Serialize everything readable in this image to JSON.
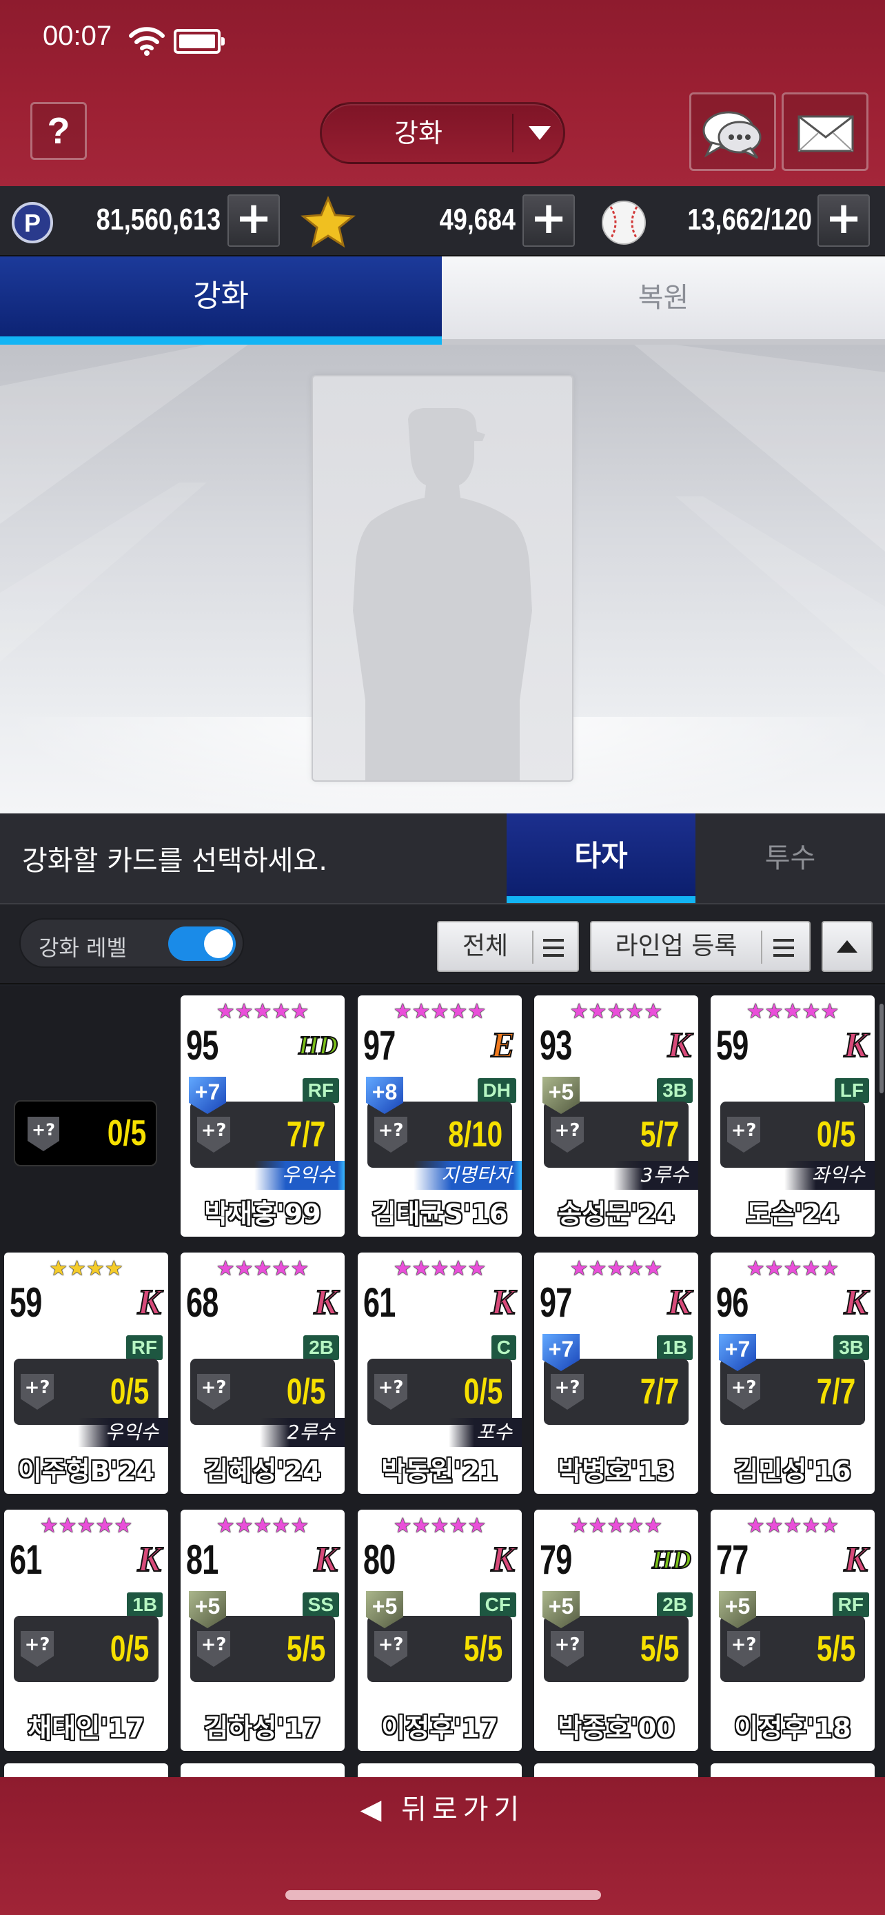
{
  "status_bar": {
    "time": "00:07"
  },
  "header": {
    "help_label": "?",
    "mode_label": "강화"
  },
  "currency": {
    "points": "81,560,613",
    "stars": "49,684",
    "balls": "13,662/120"
  },
  "tabs": {
    "enhance": "강화",
    "restore": "복원"
  },
  "select_row": {
    "message": "강화할 카드를 선택하세요.",
    "batter_tab": "타자",
    "pitcher_tab": "투수"
  },
  "filter": {
    "toggle_label": "강화 레벨",
    "all_label": "전체",
    "lineup_label": "라인업 등록"
  },
  "slot": {
    "value": "0/5"
  },
  "cards": [
    {
      "stars": "★★★★★",
      "ovr": "95",
      "team": "HD",
      "pos": "RF",
      "plus": "+7",
      "plus_color": "blue",
      "progress": "7/7",
      "skill": "우익수",
      "skill_style": "blue",
      "name": "박재홍'99"
    },
    {
      "stars": "★★★★★",
      "ovr": "97",
      "team": "E",
      "pos": "DH",
      "plus": "+8",
      "plus_color": "blue",
      "progress": "8/10",
      "skill": "지명타자",
      "skill_style": "blue",
      "name": "김태균S'16"
    },
    {
      "stars": "★★★★★",
      "ovr": "93",
      "team": "K",
      "pos": "3B",
      "plus": "+5",
      "plus_color": "olive",
      "progress": "5/7",
      "skill": "3루수",
      "skill_style": "dark",
      "name": "송성문'24"
    },
    {
      "stars": "★★★★★",
      "ovr": "59",
      "team": "K",
      "pos": "LF",
      "plus": "",
      "plus_color": "",
      "progress": "0/5",
      "skill": "좌익수",
      "skill_style": "dark",
      "name": "도슨'24"
    },
    {
      "stars": "★★★★",
      "ovr": "59",
      "team": "K",
      "pos": "RF",
      "plus": "",
      "plus_color": "",
      "progress": "0/5",
      "skill": "우익수",
      "skill_style": "dark",
      "name": "이주형B'24",
      "gold": true
    },
    {
      "stars": "★★★★★",
      "ovr": "68",
      "team": "K",
      "pos": "2B",
      "plus": "",
      "plus_color": "",
      "progress": "0/5",
      "skill": "2루수",
      "skill_style": "dark",
      "name": "김혜성'24"
    },
    {
      "stars": "★★★★★",
      "ovr": "61",
      "team": "K",
      "pos": "C",
      "plus": "",
      "plus_color": "",
      "progress": "0/5",
      "skill": "포수",
      "skill_style": "dark",
      "name": "박동원'21"
    },
    {
      "stars": "★★★★★",
      "ovr": "97",
      "team": "K",
      "pos": "1B",
      "plus": "+7",
      "plus_color": "blue",
      "progress": "7/7",
      "skill": "",
      "skill_style": "",
      "name": "박병호'13"
    },
    {
      "stars": "★★★★★",
      "ovr": "96",
      "team": "K",
      "pos": "3B",
      "plus": "+7",
      "plus_color": "blue",
      "progress": "7/7",
      "skill": "",
      "skill_style": "",
      "name": "김민성'16"
    },
    {
      "stars": "★★★★★",
      "ovr": "61",
      "team": "K",
      "pos": "1B",
      "plus": "",
      "plus_color": "",
      "progress": "0/5",
      "skill": "",
      "skill_style": "",
      "name": "채태인'17"
    },
    {
      "stars": "★★★★★",
      "ovr": "81",
      "team": "K",
      "pos": "SS",
      "plus": "+5",
      "plus_color": "olive",
      "progress": "5/5",
      "skill": "",
      "skill_style": "",
      "name": "김하성'17"
    },
    {
      "stars": "★★★★★",
      "ovr": "80",
      "team": "K",
      "pos": "CF",
      "plus": "+5",
      "plus_color": "olive",
      "progress": "5/5",
      "skill": "",
      "skill_style": "",
      "name": "이정후'17"
    },
    {
      "stars": "★★★★★",
      "ovr": "79",
      "team": "HD",
      "pos": "2B",
      "plus": "+5",
      "plus_color": "olive",
      "progress": "5/5",
      "skill": "",
      "skill_style": "",
      "name": "박종호'00"
    },
    {
      "stars": "★★★★★",
      "ovr": "77",
      "team": "K",
      "pos": "RF",
      "plus": "+5",
      "plus_color": "olive",
      "progress": "5/5",
      "skill": "",
      "skill_style": "",
      "name": "이정후'18"
    }
  ],
  "footer": {
    "back_label": "◀ 뒤로가기"
  }
}
